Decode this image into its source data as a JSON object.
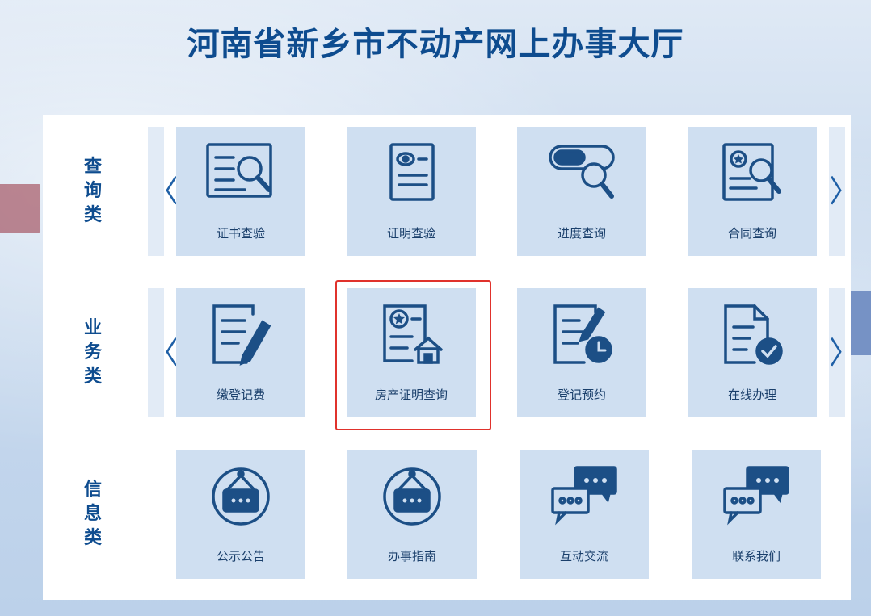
{
  "header": {
    "title": "河南省新乡市不动产网上办事大厅"
  },
  "colors": {
    "brand": "#0e4c8f",
    "icon": "#1c4f86",
    "tile_bg": "#cfdff1",
    "highlight": "#e0322c"
  },
  "nav": {
    "prev": "〈",
    "next": "〉"
  },
  "categories": {
    "query": {
      "label": "查\n询\n类",
      "tiles": [
        {
          "label": "证书查验",
          "icon": "certificate-search-icon"
        },
        {
          "label": "证明查验",
          "icon": "proof-document-icon"
        },
        {
          "label": "进度查询",
          "icon": "progress-search-icon"
        },
        {
          "label": "合同查询",
          "icon": "contract-search-icon"
        }
      ]
    },
    "business": {
      "label": "业\n务\n类",
      "tiles": [
        {
          "label": "缴登记费",
          "icon": "document-edit-icon"
        },
        {
          "label": "房产证明查询",
          "icon": "property-certificate-icon"
        },
        {
          "label": "登记预约",
          "icon": "appointment-clock-icon"
        },
        {
          "label": "在线办理",
          "icon": "online-handle-check-icon"
        }
      ]
    },
    "info": {
      "label": "信\n息\n类",
      "tiles": [
        {
          "label": "公示公告",
          "icon": "announcement-sign-icon"
        },
        {
          "label": "办事指南",
          "icon": "guide-sign-icon"
        },
        {
          "label": "互动交流",
          "icon": "chat-bubbles-icon"
        },
        {
          "label": "联系我们",
          "icon": "contact-chat-icon"
        }
      ]
    }
  }
}
